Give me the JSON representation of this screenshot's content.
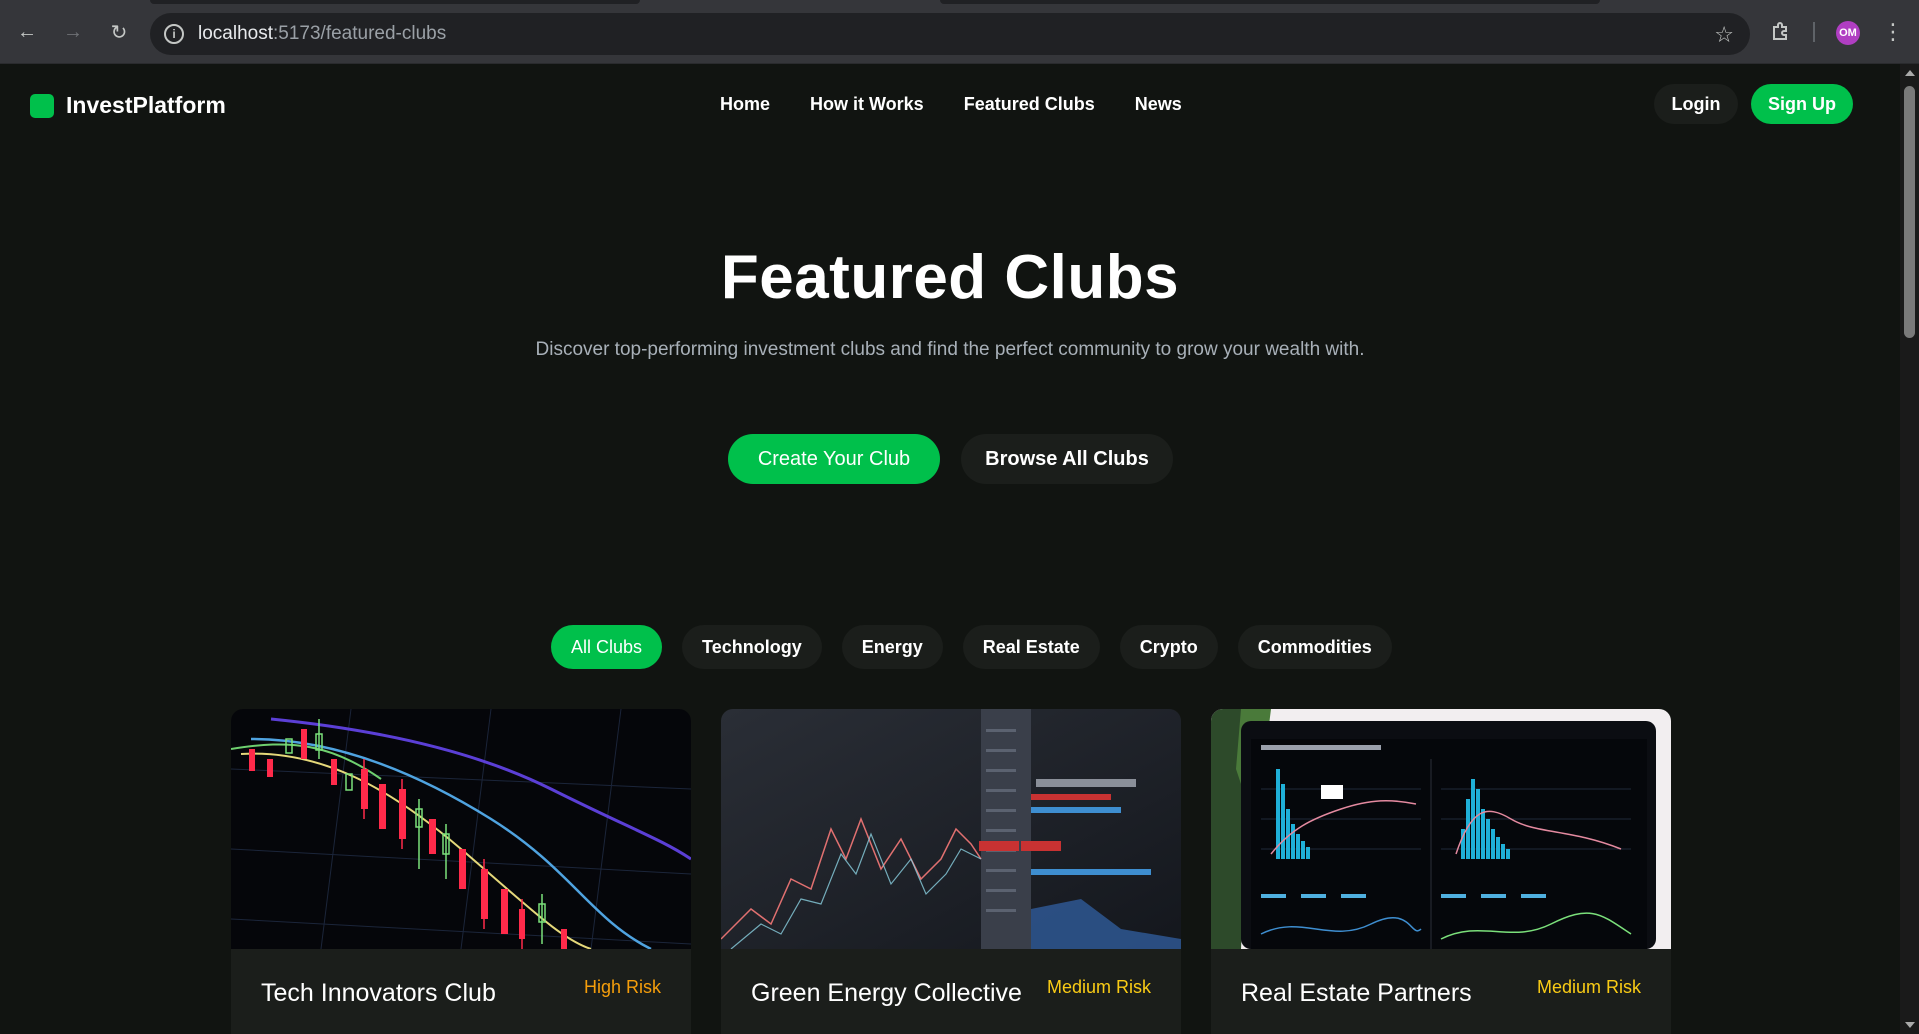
{
  "browser": {
    "url_host": "localhost",
    "url_path": ":5173/featured-clubs",
    "profile_initials": "OM"
  },
  "header": {
    "brand": "InvestPlatform",
    "nav": [
      "Home",
      "How it Works",
      "Featured Clubs",
      "News"
    ],
    "login_label": "Login",
    "signup_label": "Sign Up"
  },
  "hero": {
    "title": "Featured Clubs",
    "subtitle": "Discover top-performing investment clubs and find the perfect community to grow your wealth with.",
    "primary_cta": "Create Your Club",
    "secondary_cta": "Browse All Clubs"
  },
  "filters": {
    "items": [
      "All Clubs",
      "Technology",
      "Energy",
      "Real Estate",
      "Crypto",
      "Commodities"
    ],
    "active": "All Clubs"
  },
  "clubs": [
    {
      "name": "Tech Innovators Club",
      "risk": "High Risk",
      "risk_color": "#f59e0b"
    },
    {
      "name": "Green Energy Collective",
      "risk": "Medium Risk",
      "risk_color": "#facc15"
    },
    {
      "name": "Real Estate Partners",
      "risk": "Medium Risk",
      "risk_color": "#facc15"
    }
  ],
  "colors": {
    "accent": "#00c04b",
    "background": "#111411",
    "surface": "#1b1e1b"
  }
}
